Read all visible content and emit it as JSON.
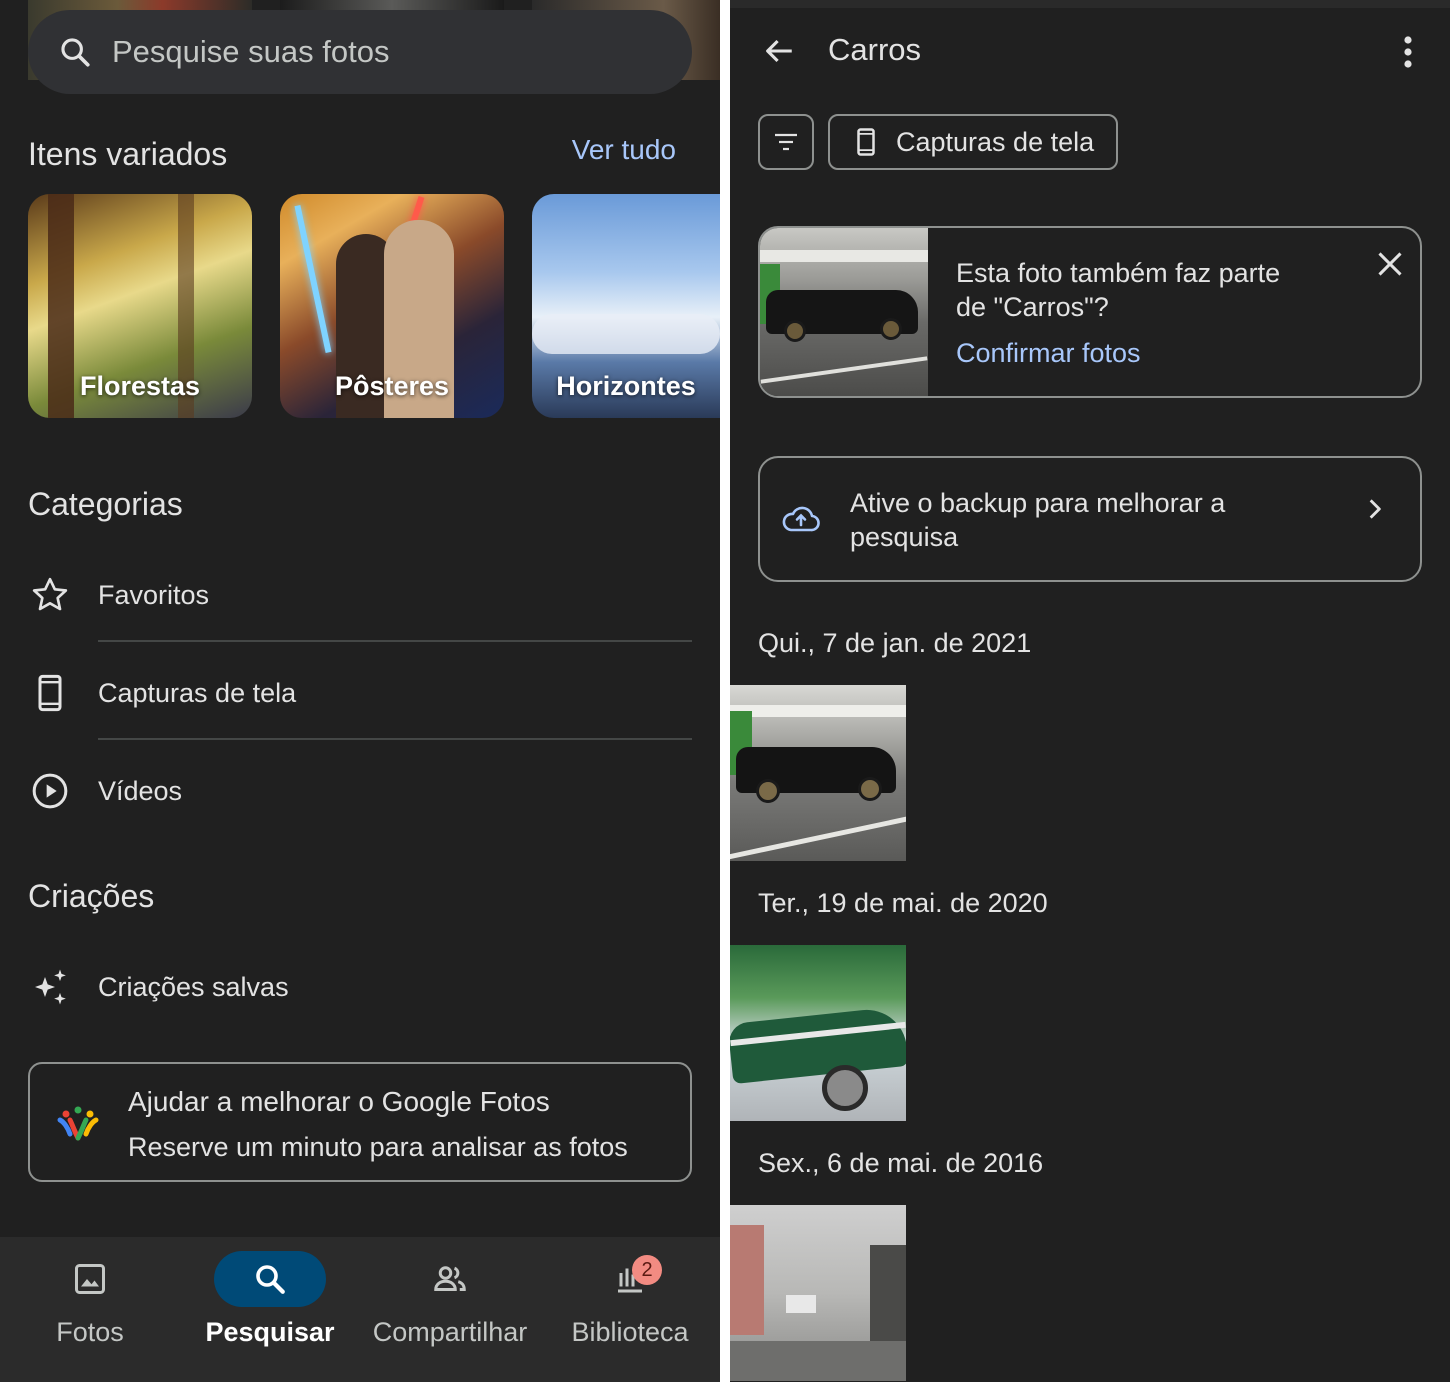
{
  "left": {
    "search": {
      "placeholder": "Pesquise suas fotos",
      "icon": "search-icon"
    },
    "varied": {
      "title": "Itens variados",
      "see_all": "Ver tudo",
      "tiles": [
        {
          "label": "Florestas"
        },
        {
          "label": "Pôsteres"
        },
        {
          "label": "Horizontes"
        }
      ]
    },
    "categories": {
      "title": "Categorias",
      "items": [
        {
          "label": "Favoritos",
          "icon": "star-icon"
        },
        {
          "label": "Capturas de tela",
          "icon": "phone-icon"
        },
        {
          "label": "Vídeos",
          "icon": "play-circle-icon"
        }
      ]
    },
    "creations": {
      "title": "Criações",
      "items": [
        {
          "label": "Criações salvas",
          "icon": "sparkle-icon"
        }
      ]
    },
    "help_card": {
      "title": "Ajudar a melhorar o Google Fotos",
      "subtitle": "Reserve um minuto para analisar as fotos"
    },
    "bottom_nav": {
      "items": [
        {
          "label": "Fotos",
          "icon": "image-icon",
          "active": false
        },
        {
          "label": "Pesquisar",
          "icon": "search-icon",
          "active": true
        },
        {
          "label": "Compartilhar",
          "icon": "people-icon",
          "active": false
        },
        {
          "label": "Biblioteca",
          "icon": "library-icon",
          "active": false,
          "badge": "2"
        }
      ]
    }
  },
  "right": {
    "title": "Carros",
    "chips": {
      "screenshots": "Capturas de tela"
    },
    "suggestion": {
      "question_line1": "Esta foto também faz parte",
      "question_line2": "de \"Carros\"?",
      "link": "Confirmar fotos"
    },
    "backup": {
      "line1": "Ative o backup para melhorar a",
      "line2": "pesquisa"
    },
    "groups": [
      {
        "date": "Qui., 7 de jan. de 2021"
      },
      {
        "date": "Ter., 19 de mai. de 2020"
      },
      {
        "date": "Sex., 6 de mai. de 2016"
      }
    ]
  },
  "colors": {
    "background": "#202020",
    "accent_link": "#a8c7fa",
    "active_pill": "#004a77",
    "badge": "#f28b82",
    "outline": "#8e918f"
  }
}
